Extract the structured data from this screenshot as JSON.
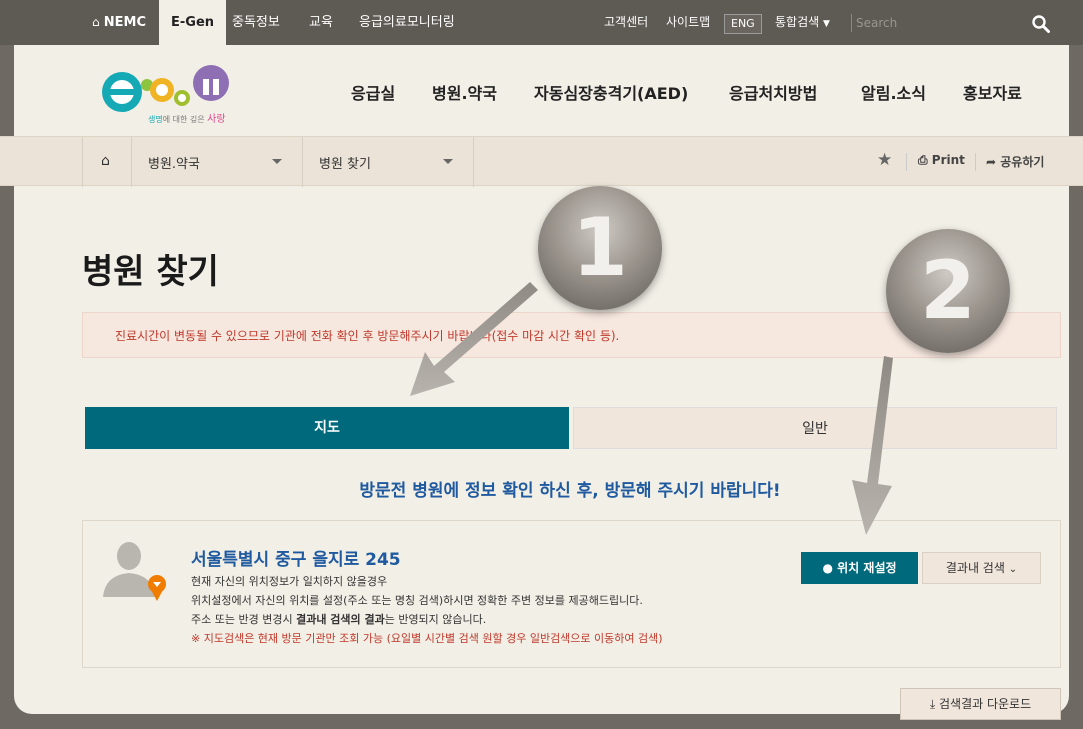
{
  "topbar": {
    "home_label": "NEMC",
    "tabs": [
      "E-Gen",
      "중독정보",
      "교육",
      "응급의료모니터링"
    ],
    "util": [
      "고객센터",
      "사이트맵"
    ],
    "eng": "ENG",
    "search_scope": "통합검색",
    "search_placeholder": "Search"
  },
  "logo": {
    "tagline_a": "생명",
    "tagline_b": "에 대한 깊은 ",
    "tagline_c": "사랑"
  },
  "gnb": [
    "응급실",
    "병원.약국",
    "자동심장충격기(AED)",
    "응급처치방법",
    "알림.소식",
    "홍보자료"
  ],
  "breadcrumb": {
    "level1": "병원.약국",
    "level2": "병원 찾기",
    "print": "Print",
    "share": "공유하기"
  },
  "page": {
    "title": "병원 찾기",
    "notice": "진료시간이 변동될 수 있으므로 기관에 전화 확인 후 방문해주시기 바랍니다(접수 마감 시간 확인 등).",
    "tab_map": "지도",
    "tab_general": "일반",
    "banner": "방문전 병원에 정보 확인 하신 후, 방문해 주시기 바랍니다!"
  },
  "location": {
    "address": "서울특별시 중구 을지로 245",
    "line1": "현재 자신의 위치정보가 일치하지 않을경우",
    "line2": "위치설정에서 자신의 위치를 설정(주소 또는 명칭 검색)하시면 정확한 주변 정보를 제공해드립니다.",
    "line3_a": "주소 또는 반경 변경시 ",
    "line3_b": "결과내 검색의 결과",
    "line3_c": "는 반영되지 않습니다.",
    "line4": "※ 지도검색은 현재 방문 기관만 조회 가능 (요일별 시간별 검색 원할 경우 일반검색으로 이동하여 검색)",
    "reset_button": "위치 재설정",
    "search_in_results": "결과내 검색"
  },
  "download_button": "검색결과 다운로드",
  "annotations": [
    "1",
    "2"
  ],
  "colors": {
    "primary": "#006a7c",
    "link_blue": "#1f5aa0",
    "notice_red": "#c0392b",
    "marker_orange": "#f07c00"
  }
}
